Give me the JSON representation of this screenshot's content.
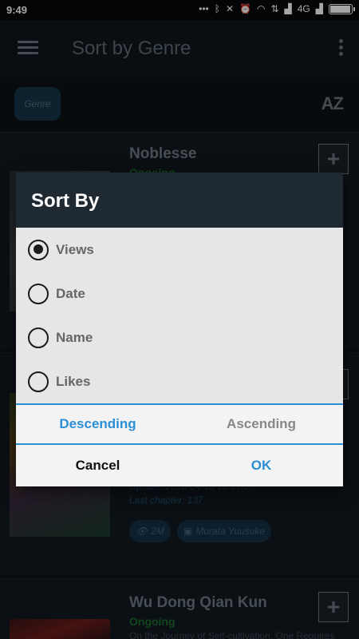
{
  "status_bar": {
    "time": "9:49",
    "icons": [
      "dots-icon",
      "bluetooth-icon",
      "mute-icon",
      "alarm-icon",
      "wifi-icon",
      "data-arrows-icon",
      "signal-icon",
      "network-4g",
      "signal-icon-2",
      "battery-icon"
    ],
    "network_label": "4G"
  },
  "app_bar": {
    "title": "Sort by Genre"
  },
  "filter": {
    "genre_chip": "Genre",
    "sort_icon_text": "AZ"
  },
  "cards": [
    {
      "title": "Noblesse",
      "status": "Ongoing"
    },
    {
      "update_text": "Update: 2018-04-18 10:37:00",
      "last_chapter": "Last chapter: 137",
      "views": "2M",
      "author": "Murata Yuusuke"
    },
    {
      "title": "Wu Dong Qian Kun",
      "status": "Ongoing",
      "description": "On the Journey of Self-cultivation, One Requires"
    }
  ],
  "dialog": {
    "title": "Sort By",
    "options": [
      {
        "label": "Views",
        "checked": true
      },
      {
        "label": "Date",
        "checked": false
      },
      {
        "label": "Name",
        "checked": false
      },
      {
        "label": "Likes",
        "checked": false
      }
    ],
    "order": {
      "descending": "Descending",
      "ascending": "Ascending",
      "selected": "Descending"
    },
    "actions": {
      "cancel": "Cancel",
      "ok": "OK"
    }
  },
  "colors": {
    "accent": "#2b8fd6",
    "dialog_header": "#1f2932",
    "ongoing_green": "#1e6a2b"
  }
}
